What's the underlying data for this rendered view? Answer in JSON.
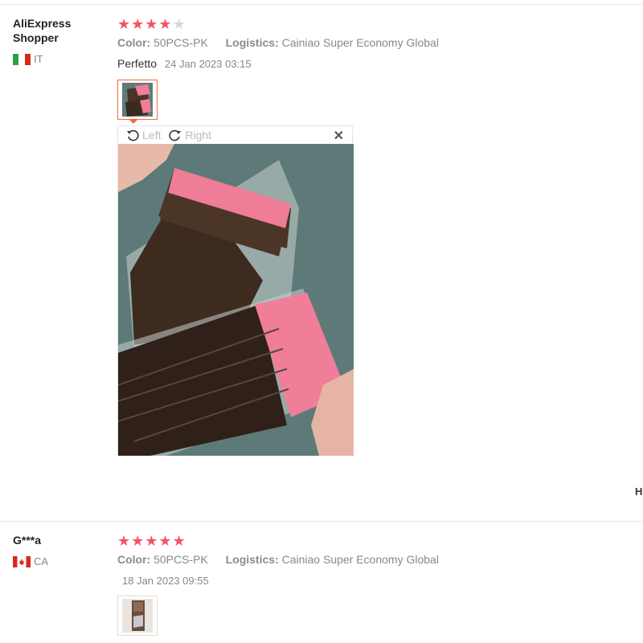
{
  "reviews": [
    {
      "user": "AliExpress Shopper",
      "country_code": "IT",
      "rating": 4,
      "color_label": "Color:",
      "color_value": "50PCS-PK",
      "logistics_label": "Logistics:",
      "logistics_value": "Cainiao Super Economy Global",
      "feedback": "Perfetto",
      "date": "24 Jan 2023 03:15"
    },
    {
      "user": "G***a",
      "country_code": "CA",
      "rating": 5,
      "color_label": "Color:",
      "color_value": "50PCS-PK",
      "logistics_label": "Logistics:",
      "logistics_value": "Cainiao Super Economy Global",
      "feedback": "",
      "date": "18 Jan 2023 09:55"
    }
  ],
  "viewer": {
    "rotate_left_label": "Left",
    "rotate_right_label": "Right",
    "close_glyph": "✕"
  },
  "edge_text": "H",
  "icons": [
    "rotate-left-icon",
    "rotate-right-icon",
    "close-icon",
    "star-icon"
  ],
  "colors": {
    "star": "#f4545f",
    "star_empty": "#d6d6d6",
    "thumb_selected": "#f46a3c"
  }
}
